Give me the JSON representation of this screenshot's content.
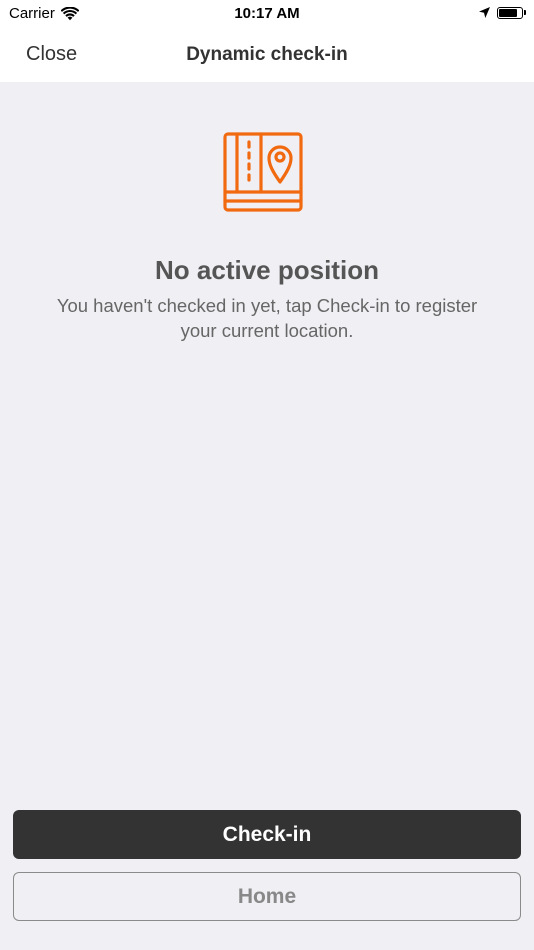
{
  "status_bar": {
    "carrier": "Carrier",
    "time": "10:17 AM",
    "battery_level": 0.9
  },
  "nav": {
    "close_label": "Close",
    "title": "Dynamic check-in"
  },
  "empty_state": {
    "icon": "map-pin-icon",
    "icon_color": "#f26a10",
    "title": "No active position",
    "message": "You haven't checked in yet, tap Check-in to register your current location."
  },
  "actions": {
    "checkin_label": "Check-in",
    "home_label": "Home"
  }
}
